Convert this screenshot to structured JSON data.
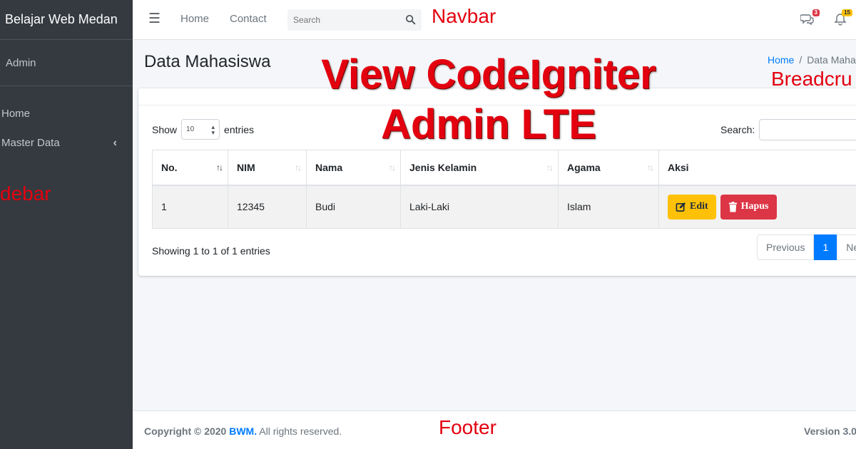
{
  "sidebar": {
    "brand": "Belajar Web Medan",
    "user": "Admin",
    "items": [
      {
        "label": "Home"
      },
      {
        "label": "Master Data"
      }
    ],
    "annotation": "debar"
  },
  "navbar": {
    "links": [
      "Home",
      "Contact"
    ],
    "search_placeholder": "Search",
    "messages_badge": "3",
    "notifications_badge": "15",
    "annotation": "Navbar"
  },
  "header": {
    "title": "Data Mahasiswa",
    "breadcrumb_home": "Home",
    "breadcrumb_current": "Data Maha",
    "breadcrumb_annotation": "Breadcru"
  },
  "overlay": {
    "line1": "View CodeIgniter",
    "line2": "Admin LTE"
  },
  "table_controls": {
    "show_label": "Show",
    "page_size": "10",
    "entries_label": "entries",
    "search_label": "Search:"
  },
  "table": {
    "columns": [
      "No.",
      "NIM",
      "Nama",
      "Jenis Kelamin",
      "Agama",
      "Aksi"
    ],
    "rows": [
      {
        "no": "1",
        "nim": "12345",
        "nama": "Budi",
        "jenis_kelamin": "Laki-Laki",
        "agama": "Islam"
      }
    ],
    "edit_label": "Edit",
    "delete_label": "Hapus"
  },
  "info": "Showing 1 to 1 of 1 entries",
  "pagination": {
    "previous": "Previous",
    "current": "1",
    "next": "Ne"
  },
  "footer": {
    "copyright_prefix": "Copyright © 2020",
    "brand": "BWM.",
    "suffix": "All rights reserved.",
    "annotation": "Footer",
    "version": "Version 3.0"
  },
  "colors": {
    "sidebar_bg": "#343a40",
    "primary": "#007bff",
    "warning": "#ffc107",
    "danger": "#dc3545",
    "annotation_red": "#e3000f"
  }
}
